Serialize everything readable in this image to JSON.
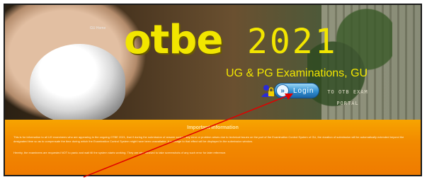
{
  "hero": {
    "corner_label": "GU Home",
    "title_part1": "otbe",
    "title_part2": "2021",
    "subtitle": "UG & PG Examinations, GU",
    "login_label": "Login",
    "portal_line1": "TO OTB EXAM",
    "portal_line2": "PORTAL"
  },
  "notice": {
    "title": "Important Information",
    "paragraph1": "This is for information to all UG examinees who are appearing in the ongoing OTBE 2021, that if during the submission of answer scripts, any error or problem arises due to technical issues on the part of the Examination Control System of GU, the duration of submission will be automatically extended beyond the designated time so as to compensate the time during which the Examination Control System might have been unavailable. A message to that effect will be displayed in the submission window.",
    "paragraph2": "Hereby, the examinees are requested NOT to panic and wait till the system starts working. They are also advised to take screenshots of any such error for later reference."
  },
  "colors": {
    "title_yellow": "#f2e600",
    "notice_orange": "#f28a00",
    "arrow_red": "#e00000",
    "login_blue": "#2f8fd1"
  }
}
